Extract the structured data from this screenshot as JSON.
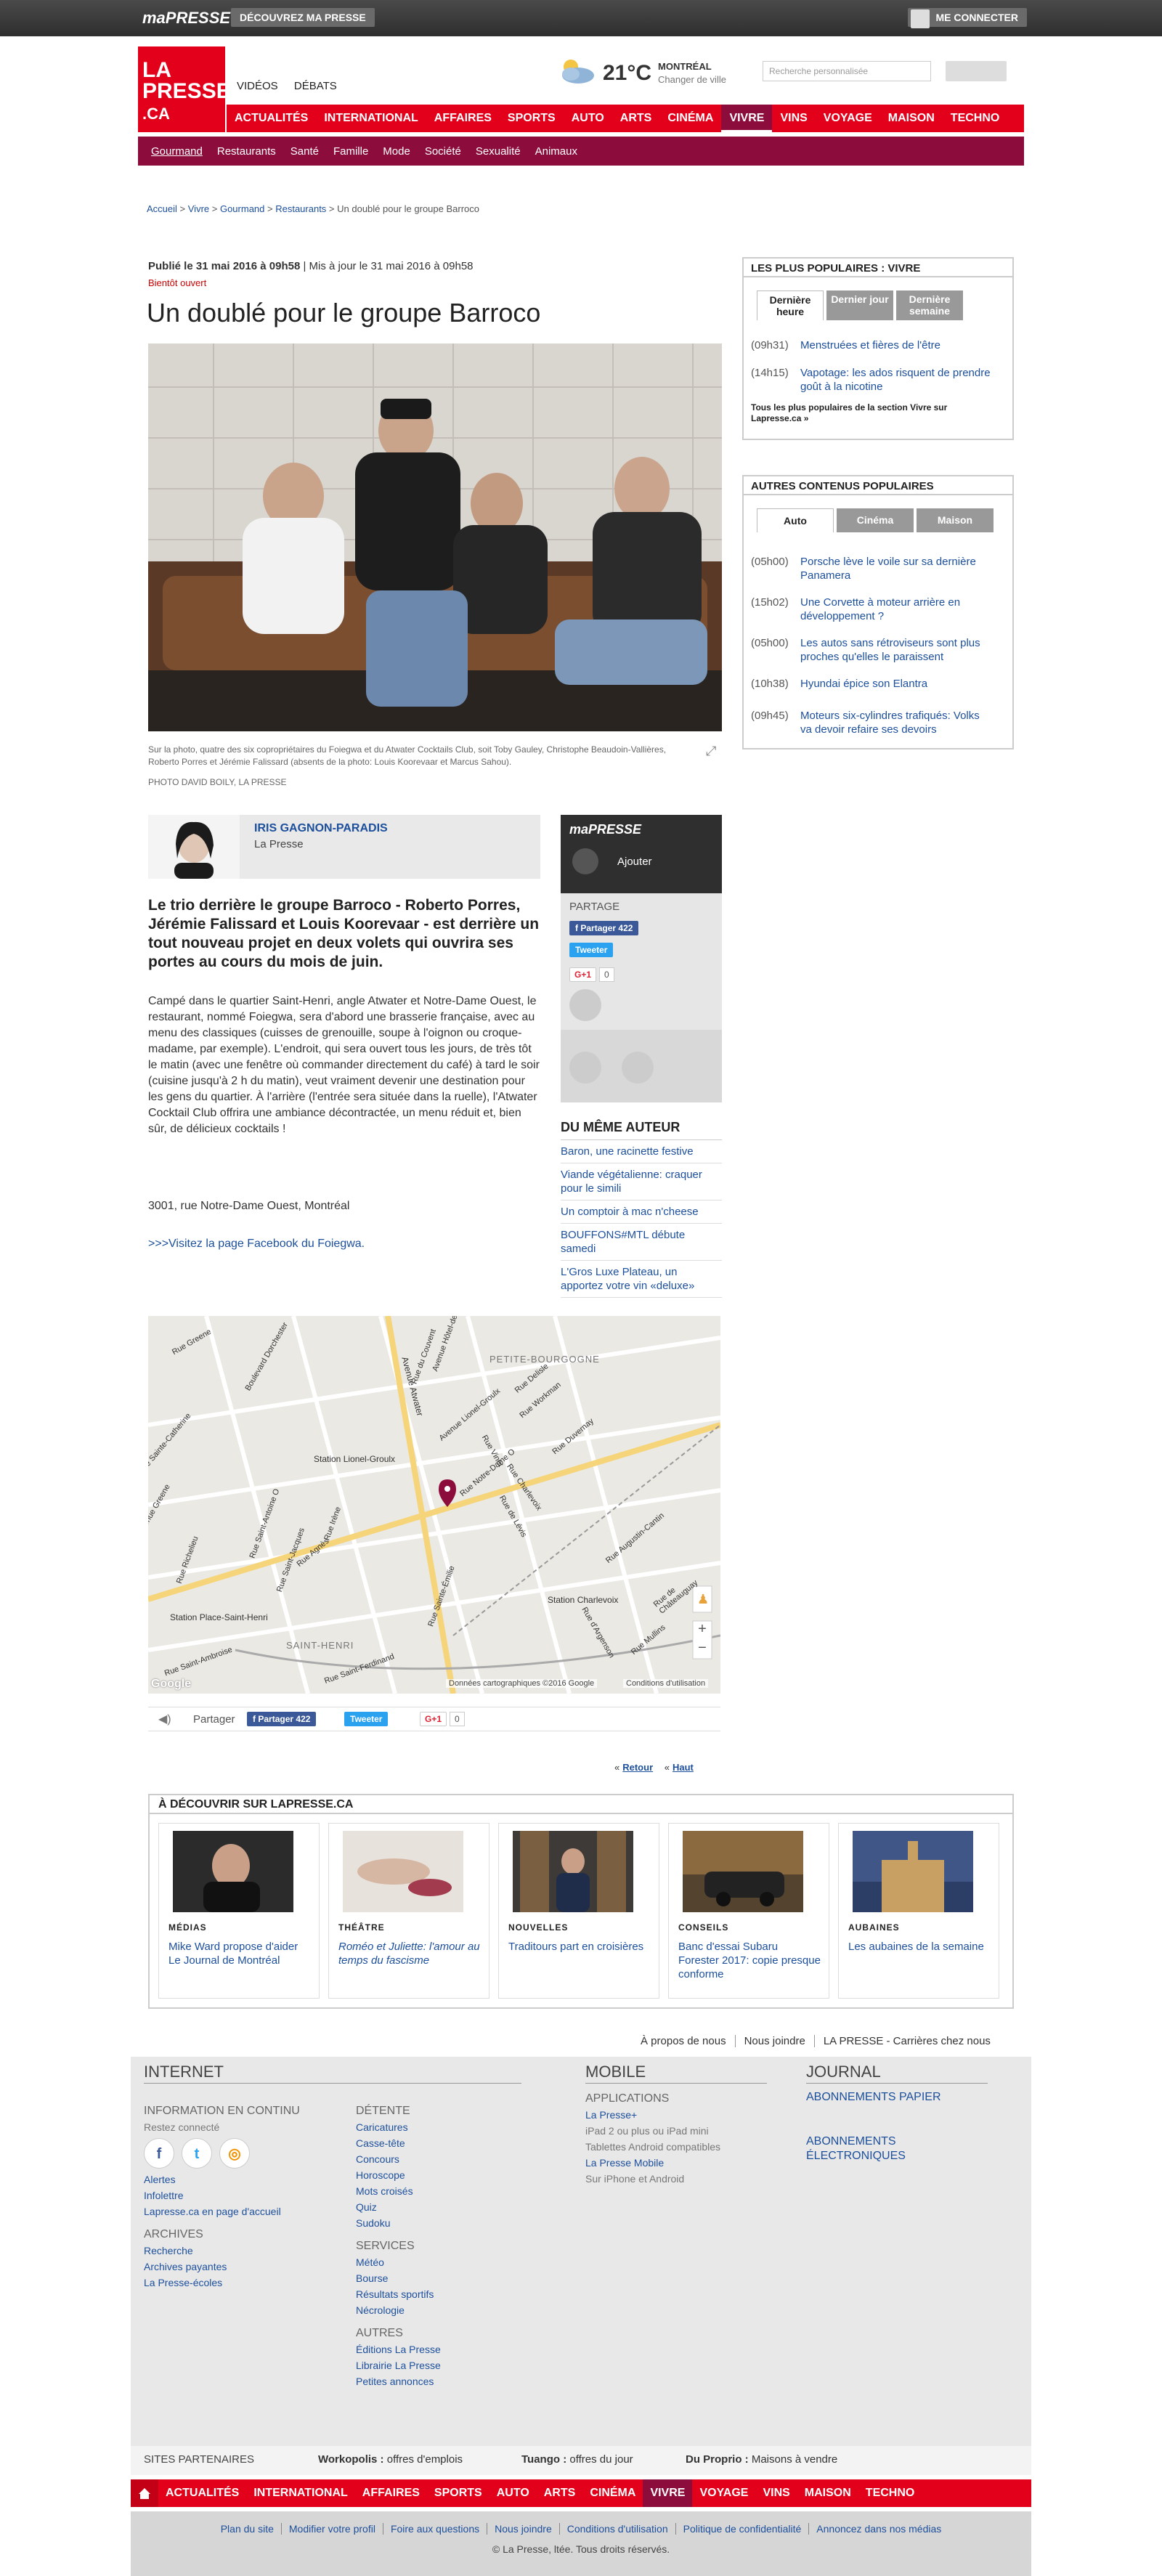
{
  "topbar": {
    "brand": "maPRESSE",
    "discover": "DÉCOUVREZ MA PRESSE",
    "login": "ME CONNECTER"
  },
  "logo": {
    "line1": "LA",
    "line2": "PRESSE",
    "line3": ".CA"
  },
  "header_links": [
    "VIDÉOS",
    "DÉBATS"
  ],
  "weather": {
    "temp": "21°C",
    "city": "MONTRÉAL",
    "change": "Changer de ville"
  },
  "search": {
    "placeholder": "Recherche personnalisée"
  },
  "nav_main": [
    "ACTUALITÉS",
    "INTERNATIONAL",
    "AFFAIRES",
    "SPORTS",
    "AUTO",
    "ARTS",
    "CINÉMA",
    "VIVRE",
    "VINS",
    "VOYAGE",
    "MAISON",
    "TECHNO"
  ],
  "nav_active": "VIVRE",
  "nav_sub": [
    "Gourmand",
    "Restaurants",
    "Santé",
    "Famille",
    "Mode",
    "Société",
    "Sexualité",
    "Animaux"
  ],
  "breadcrumb": {
    "items": [
      "Accueil",
      "Vivre",
      "Gourmand",
      "Restaurants"
    ],
    "current": "Un doublé pour le groupe Barroco"
  },
  "article": {
    "published": "Publié le 31 mai 2016 à 09h58",
    "updated": "Mis à jour le 31 mai 2016 à 09h58",
    "kicker": "Bientôt ouvert",
    "title": "Un doublé pour le groupe Barroco",
    "caption": "Sur la photo, quatre des six copropriétaires du Foiegwa et du Atwater Cocktails Club, soit Toby Gauley, Christophe Beaudoin-Vallières, Roberto Porres et Jérémie Falissard (absents de la photo: Louis Koorevaar et Marcus Sahou).",
    "credit": "PHOTO DAVID BOILY, LA PRESSE",
    "author_name": "IRIS GAGNON-PARADIS",
    "author_org": "La Presse",
    "lead": "Le trio derrière le groupe Barroco - Roberto Porres, Jérémie Falissard et Louis Koorevaar - est derrière un tout nouveau projet en deux volets qui ouvrira ses portes au cours du mois de juin.",
    "body": "Campé dans le quartier Saint-Henri, angle Atwater et Notre-Dame Ouest, le restaurant, nommé Foiegwa, sera d'abord une brasserie française, avec au menu des classiques (cuisses de grenouille, soupe à l'oignon ou croque-madame, par exemple). L'endroit, qui sera ouvert tous les jours, de très tôt le matin (avec une fenêtre où commander directement du café) à tard le soir (cuisine jusqu'à 2 h du matin), veut vraiment devenir une destination pour les gens du quartier. À l'arrière (l'entrée sera située dans la ruelle), l'Atwater Cocktail Club offrira une ambiance décontractée, un menu réduit et, bien sûr, de délicieux cocktails !",
    "address": "3001, rue Notre-Dame Ouest, Montréal",
    "fb_link": ">>>Visitez la page Facebook du Foiegwa."
  },
  "share": {
    "brand": "maPRESSE",
    "add": "Ajouter",
    "label": "PARTAGE",
    "fb": "Partager",
    "fb_count": "422",
    "tw": "Tweeter",
    "gplus": "G+1",
    "g_count": "0"
  },
  "same_author": {
    "title": "DU MÊME AUTEUR",
    "items": [
      "Baron, une racinette festive",
      "Viande végétalienne: craquer pour le simili",
      "Un comptoir à mac n'cheese",
      "BOUFFONS#MTL débute samedi",
      "L'Gros Luxe Plateau, un apportez votre vin «deluxe»"
    ]
  },
  "map": {
    "labels": [
      "PETITE-BOURGOGNE",
      "SAINT-HENRI",
      "Station Lionel-Groulx",
      "Station Place-Saint-Henri",
      "Station Charlevoix",
      "Avenue Atwater",
      "Rue Notre-Dame O",
      "Rue Saint-Jacques",
      "Rue Sainte-Émilie",
      "Rue Charlevoix",
      "Rue de Lévis",
      "Rue Augustin-Cantin",
      "Rue Saint-Antoine O",
      "Rue Workman",
      "Rue Delisle",
      "Rue Richelieu",
      "Rue d'Argenson",
      "Rue Mullins",
      "Rue Sainte-Catherine",
      "Rue Greene",
      "Boulevard Dorchester",
      "Avenue Lionel-Groulx",
      "Rue Duvernay",
      "Rue Vinet",
      "Rue du Couvent",
      "Rue de Châteauguay",
      "Avenue Hôtel-de-Ville",
      "Rue Saint-Ambroise",
      "Rue Saint-Ferdinand",
      "Rue Irène",
      "Rue Agnès",
      "Avenue Greene"
    ],
    "attribution": "Données cartographiques ©2016 Google",
    "terms": "Conditions d'utilisation",
    "google": "Google"
  },
  "share_bottom": {
    "label": "Partager",
    "fb": "Partager",
    "fb_count": "422",
    "tw": "Tweeter",
    "gplus": "G+1",
    "g_count": "0"
  },
  "page_nav": {
    "back": "Retour",
    "top": "Haut"
  },
  "popular_vivre": {
    "title": "LES PLUS POPULAIRES : VIVRE",
    "tabs": [
      "Dernière heure",
      "Dernier jour",
      "Dernière semaine"
    ],
    "items": [
      {
        "time": "(09h31)",
        "text": "Menstruées et fières de l'être"
      },
      {
        "time": "(14h15)",
        "text": "Vapotage: les ados risquent de prendre goût à la nicotine"
      }
    ],
    "more": "Tous les plus populaires de la section Vivre sur Lapresse.ca »"
  },
  "popular_other": {
    "title": "AUTRES CONTENUS POPULAIRES",
    "tabs": [
      "Auto",
      "Cinéma",
      "Maison"
    ],
    "items": [
      {
        "time": "(05h00)",
        "text": "Porsche lève le voile sur sa dernière Panamera"
      },
      {
        "time": "(15h02)",
        "text": "Une Corvette à moteur arrière en développement ?"
      },
      {
        "time": "(05h00)",
        "text": "Les autos sans rétroviseurs sont plus proches qu'elles le paraissent"
      },
      {
        "time": "(10h38)",
        "text": "Hyundai épice son Elantra"
      },
      {
        "time": "(09h45)",
        "text": "Moteurs six-cylindres trafiqués: Volks va devoir refaire ses devoirs"
      }
    ]
  },
  "discover": {
    "title": "À DÉCOUVRIR SUR LAPRESSE.CA",
    "cards": [
      {
        "cat": "MÉDIAS",
        "title": "Mike Ward propose d'aider Le Journal de Montréal"
      },
      {
        "cat": "THÉÂTRE",
        "title": "Roméo et Juliette: l'amour au temps du fascisme"
      },
      {
        "cat": "NOUVELLES",
        "title": "Traditours part en croisières"
      },
      {
        "cat": "CONSEILS",
        "title": "Banc d'essai Subaru Forester 2017: copie presque conforme"
      },
      {
        "cat": "AUBAINES",
        "title": "Les aubaines de la semaine"
      }
    ]
  },
  "footer_top_links": [
    "À propos de nous",
    "Nous joindre",
    "LA PRESSE - Carrières chez nous"
  ],
  "footer": {
    "internet": "INTERNET",
    "mobile": "MOBILE",
    "journal": "JOURNAL",
    "info_title": "INFORMATION EN CONTINU",
    "stay": "Restez connecté",
    "info_links": [
      "Alertes",
      "Infolettre",
      "Lapresse.ca en page d'accueil"
    ],
    "archives_title": "ARCHIVES",
    "archives_links": [
      "Recherche",
      "Archives payantes",
      "La Presse-écoles"
    ],
    "detente_title": "DÉTENTE",
    "detente_links": [
      "Caricatures",
      "Casse-tête",
      "Concours",
      "Horoscope",
      "Mots croisés",
      "Quiz",
      "Sudoku"
    ],
    "services_title": "SERVICES",
    "services_links": [
      "Météo",
      "Bourse",
      "Résultats sportifs",
      "Nécrologie"
    ],
    "autres_title": "AUTRES",
    "autres_links": [
      "Éditions La Presse",
      "Librairie La Presse",
      "Petites annonces"
    ],
    "apps_title": "APPLICATIONS",
    "apps": [
      {
        "link": "La Presse+",
        "desc": "iPad 2 ou plus ou iPad mini"
      },
      {
        "link": "",
        "desc": "Tablettes Android compatibles"
      },
      {
        "link": "La Presse Mobile",
        "desc": "Sur iPhone et Android"
      }
    ],
    "journal_links": [
      "ABONNEMENTS PAPIER",
      "ABONNEMENTS ÉLECTRONIQUES"
    ]
  },
  "partners": {
    "title": "SITES PARTENAIRES",
    "p1b": "Workopolis :",
    "p1": " offres d'emplois",
    "p2b": "Tuango :",
    "p2": " offres du jour",
    "p3b": "Du Proprio :",
    "p3": " Maisons à vendre"
  },
  "nav_footer": [
    "ACTUALITÉS",
    "INTERNATIONAL",
    "AFFAIRES",
    "SPORTS",
    "AUTO",
    "ARTS",
    "CINÉMA",
    "VIVRE",
    "VOYAGE",
    "VINS",
    "MAISON",
    "TECHNO"
  ],
  "legal": {
    "links": [
      "Plan du site",
      "Modifier votre profil",
      "Foire aux questions",
      "Nous joindre",
      "Conditions d'utilisation",
      "Politique de confidentialité",
      "Annoncez dans nos médias"
    ],
    "copyright": "© La Presse, ltée. Tous droits réservés."
  }
}
